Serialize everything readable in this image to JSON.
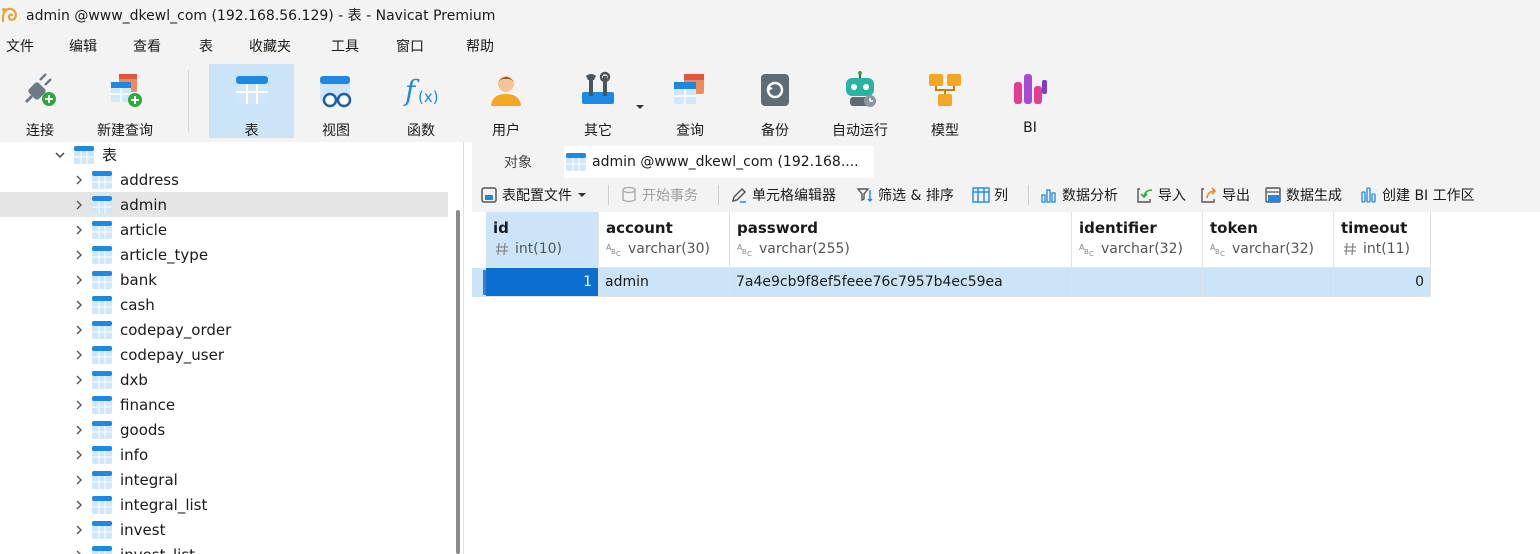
{
  "window": {
    "title": "admin @www_dkewl_com (192.168.56.129) - 表 - Navicat Premium"
  },
  "menu": [
    "文件",
    "编辑",
    "查看",
    "表",
    "收藏夹",
    "工具",
    "窗口",
    "帮助"
  ],
  "toolbar": {
    "connect": "连接",
    "new_query": "新建查询",
    "table": "表",
    "view": "视图",
    "function": "函数",
    "user": "用户",
    "other": "其它",
    "query": "查询",
    "backup": "备份",
    "automation": "自动运行",
    "model": "模型",
    "bi": "BI"
  },
  "navigator": {
    "group_label": "表",
    "tables": [
      "address",
      "admin",
      "article",
      "article_type",
      "bank",
      "cash",
      "codepay_order",
      "codepay_user",
      "dxb",
      "finance",
      "goods",
      "info",
      "integral",
      "integral_list",
      "invest",
      "invest_list"
    ],
    "selected": "admin"
  },
  "tabs": {
    "objects": "对象",
    "active": "admin @www_dkewl_com (192.168...."
  },
  "object_toolbar": {
    "profile": "表配置文件",
    "begin_transaction": "开始事务",
    "cell_editor": "单元格编辑器",
    "filter_sort": "筛选 & 排序",
    "columns": "列",
    "data_analysis": "数据分析",
    "import": "导入",
    "export": "导出",
    "data_generation": "数据生成",
    "create_bi": "创建 BI 工作区"
  },
  "grid": {
    "columns": [
      {
        "name": "id",
        "type": "int(10)",
        "kind": "num"
      },
      {
        "name": "account",
        "type": "varchar(30)",
        "kind": "text"
      },
      {
        "name": "password",
        "type": "varchar(255)",
        "kind": "text"
      },
      {
        "name": "identifier",
        "type": "varchar(32)",
        "kind": "text"
      },
      {
        "name": "token",
        "type": "varchar(32)",
        "kind": "text"
      },
      {
        "name": "timeout",
        "type": "int(11)",
        "kind": "num"
      }
    ],
    "rows": [
      [
        "1",
        "admin",
        "7a4e9cb9f8ef5feee76c7957b4ec59ea",
        "",
        "",
        "0"
      ]
    ]
  },
  "colors": {
    "chrome": "#f3f3f3",
    "selection": "#cce4f7",
    "focus_cell": "#0a6fd1",
    "table_icon_blue": "#1e88e5"
  }
}
